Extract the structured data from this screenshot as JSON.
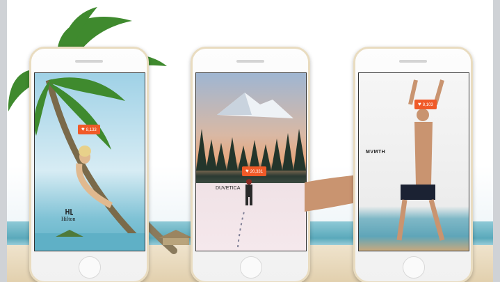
{
  "phones": [
    {
      "like_count": "8,133",
      "brand": "Hilton",
      "brand_icon": "hilton-logo-icon",
      "heart_icon": "heart-icon",
      "accent": "#f05a28"
    },
    {
      "like_count": "20,331",
      "brand": "DUVETICA",
      "heart_icon": "heart-icon",
      "accent": "#f05a28"
    },
    {
      "like_count": "8,103",
      "brand": "MVMTH",
      "heart_icon": "heart-icon",
      "accent": "#f05a28"
    }
  ],
  "colors": {
    "badge": "#f05a28",
    "phone_frame": "#e9dcc0",
    "sea": "#5aa9bb",
    "sand": "#e2d0ae"
  }
}
